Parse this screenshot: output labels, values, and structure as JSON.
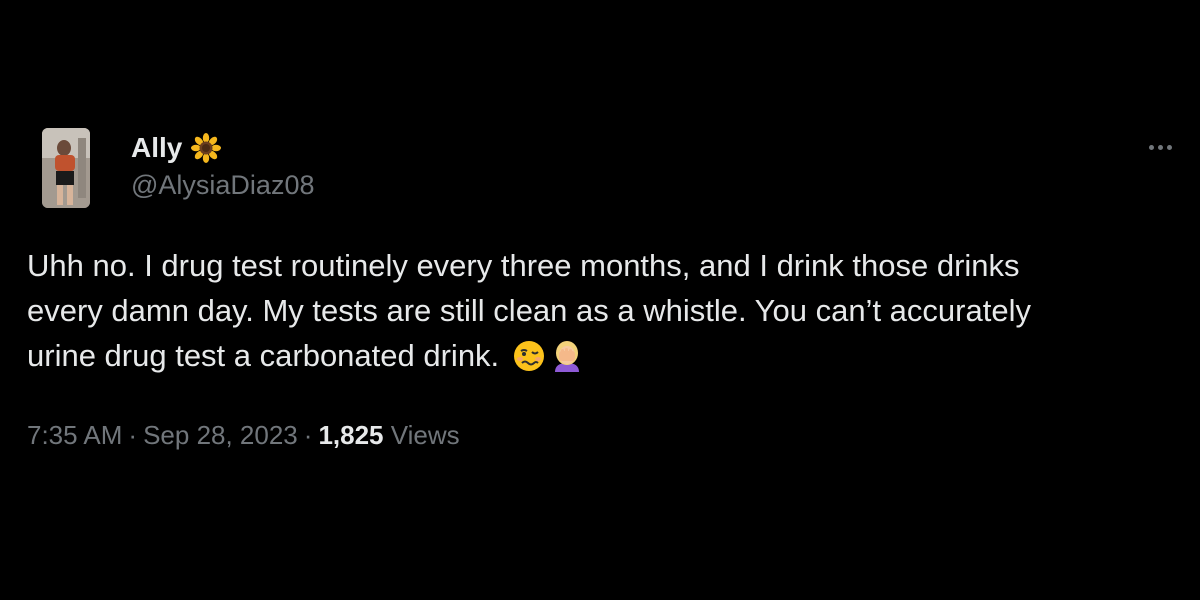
{
  "author": {
    "name": "Ally",
    "handle": "@AlysiaDiaz08",
    "name_emoji": "sunflower-icon"
  },
  "tweet": {
    "lines": [
      "Uhh no. I drug test routinely every three months, and I drink those drinks",
      "every damn day. My tests are still clean as a whistle. You can’t accurately",
      "urine drug test a carbonated drink."
    ],
    "trailing_emojis": [
      "woozy-face-icon",
      "woman-facepalming-icon"
    ]
  },
  "meta": {
    "time": "7:35 AM",
    "separator": "·",
    "date": "Sep 28, 2023",
    "views_count": "1,825",
    "views_label": "Views"
  },
  "colors": {
    "background": "#000000",
    "text_primary": "#e7e9ea",
    "text_secondary": "#71767b"
  }
}
